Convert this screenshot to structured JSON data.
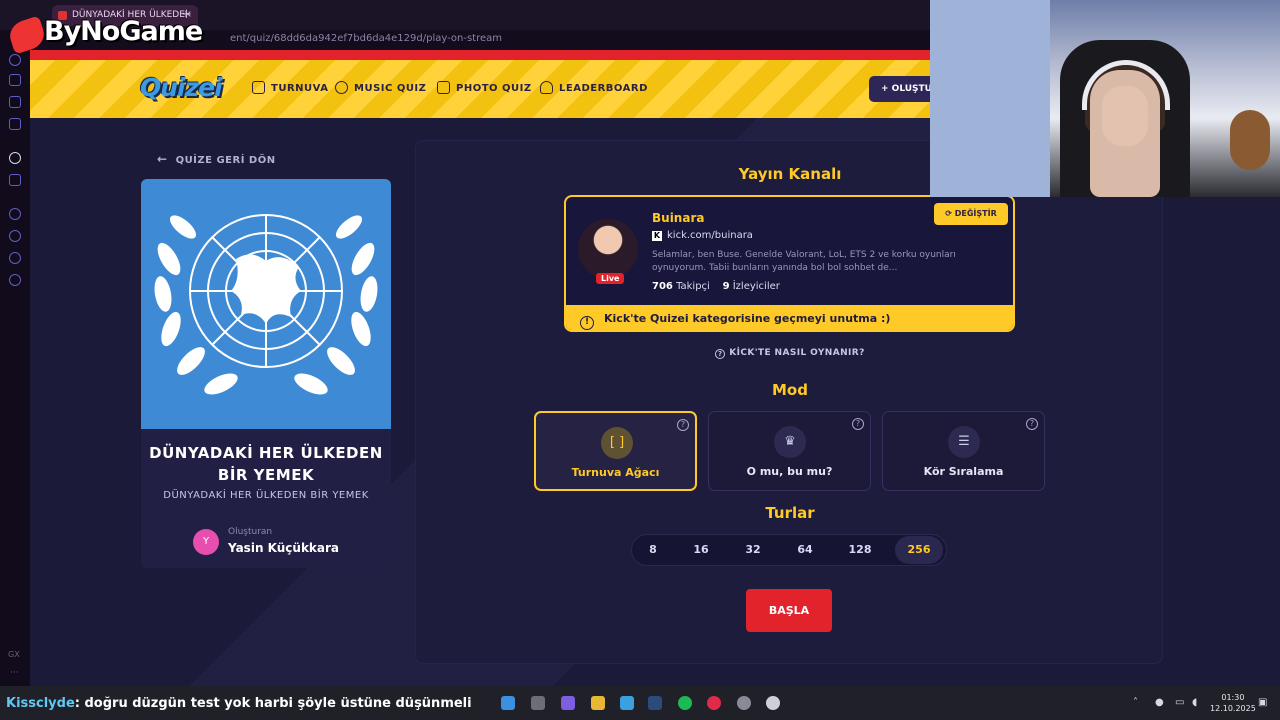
{
  "browser": {
    "tab_title": "DÜNYADAKİ HER ÜLKEDE",
    "url": "ent/quiz/68dd6da942ef7bd6da4e129d/play-on-stream"
  },
  "watermark": {
    "text": "ByNoGame"
  },
  "nav": {
    "logo": "Quizei",
    "items": [
      {
        "label": "TURNUVA",
        "icon": "trophy-icon"
      },
      {
        "label": "MUSIC QUIZ",
        "icon": "music-note-icon"
      },
      {
        "label": "PHOTO QUIZ",
        "icon": "camera-icon"
      },
      {
        "label": "LEADERBOARD",
        "icon": "medal-icon"
      }
    ],
    "create_label": "+ OLUŞTU"
  },
  "back_link": "QUİZE GERİ DÖN",
  "quiz": {
    "title": "DÜNYADAKİ HER ÜLKEDEN BİR YEMEK",
    "subtitle": "DÜNYADAKİ HER ÜLKEDEN BİR YEMEK",
    "author_label": "Oluşturan",
    "author_initial": "Y",
    "author_name": "Yasin Küçükkara"
  },
  "channel_section": {
    "title": "Yayın Kanalı",
    "name": "Buinara",
    "link": "kick.com/buinara",
    "live_badge": "Live",
    "description": "Selamlar, ben Buse. Genelde Valorant, LoL, ETS 2 ve korku oyunları oynuyorum. Tabii bunların yanında bol bol sohbet de...",
    "followers_count": "706",
    "followers_label": "Takipçi",
    "viewers_count": "9",
    "viewers_label": "İzleyiciler",
    "change_label": "DEĞİŞTİR",
    "warning": "Kick'te Quizei kategorisine geçmeyi unutma :)"
  },
  "howto_label": "KİCK'TE NASIL OYNANIR?",
  "mod": {
    "title": "Mod",
    "options": [
      {
        "label": "Turnuva Ağacı",
        "icon": "bracket-icon",
        "glyph": "[ ]"
      },
      {
        "label": "O mu, bu mu?",
        "icon": "crown-icon",
        "glyph": "♛"
      },
      {
        "label": "Kör Sıralama",
        "icon": "list-icon",
        "glyph": "☰"
      }
    ],
    "selected": "Turnuva Ağacı"
  },
  "rounds": {
    "title": "Turlar",
    "options": [
      "8",
      "16",
      "32",
      "64",
      "128",
      "256"
    ],
    "selected": "256"
  },
  "start_label": "BAŞLA",
  "taskbar": {
    "chat_user": "Kissclyde",
    "chat_message": ": doğru düzgün test yok harbi şöyle üstüne düşünmeli",
    "time": "01:30",
    "date": "12.10.2025"
  },
  "colors": {
    "accent": "#ffc928",
    "danger": "#e2232c",
    "bg": "#1b1a38",
    "panel": "#1e1c3c"
  }
}
